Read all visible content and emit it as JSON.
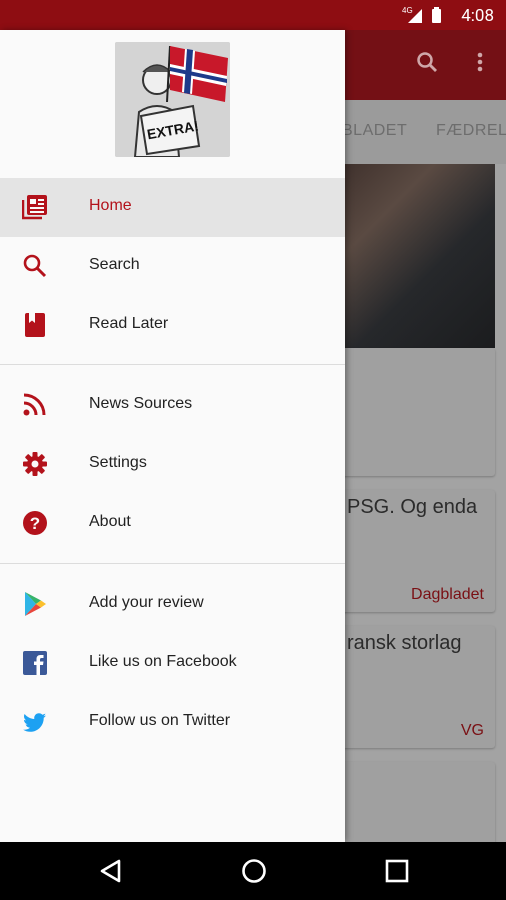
{
  "status": {
    "time": "4:08",
    "network": "4G"
  },
  "app": {
    "tabs": [
      "BLADET",
      "FÆDRELA"
    ],
    "cards": [
      {
        "text": "PSG. Og enda",
        "source": "Dagbladet"
      },
      {
        "text": "ransk storlag",
        "source": "VG"
      }
    ],
    "accent_color": "#b3121b"
  },
  "drawer": {
    "logo_text": "EXTRA!",
    "items": [
      {
        "label": "Home",
        "icon": "newspaper-icon"
      },
      {
        "label": "Search",
        "icon": "search-icon"
      },
      {
        "label": "Read Later",
        "icon": "bookmark-icon"
      }
    ],
    "items2": [
      {
        "label": "News Sources",
        "icon": "rss-icon"
      },
      {
        "label": "Settings",
        "icon": "gear-icon"
      },
      {
        "label": "About",
        "icon": "help-icon"
      }
    ],
    "items3": [
      {
        "label": "Add your review",
        "icon": "play-store-icon"
      },
      {
        "label": "Like us on Facebook",
        "icon": "facebook-icon"
      },
      {
        "label": "Follow us on Twitter",
        "icon": "twitter-icon"
      }
    ]
  }
}
